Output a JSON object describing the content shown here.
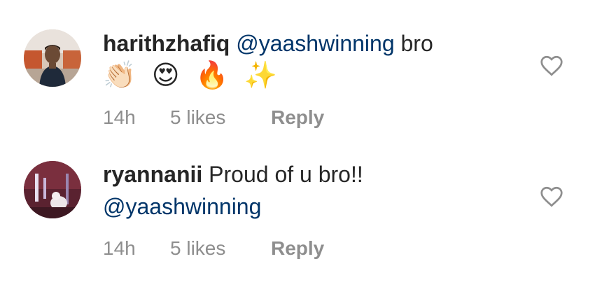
{
  "comments": [
    {
      "username": "harithzhafiq",
      "mention": "@yaashwinning",
      "text_after_mention": " bro",
      "emojis": "👏🏻 😍 🔥 ✨",
      "time": "14h",
      "likes": "5 likes",
      "reply": "Reply",
      "heart_icon": "heart-outline-icon"
    },
    {
      "username": "ryannanii",
      "text": " Proud of u bro!!",
      "mention": "@yaashwinning",
      "time": "14h",
      "likes": "5 likes",
      "reply": "Reply",
      "heart_icon": "heart-outline-icon"
    }
  ],
  "colors": {
    "text": "#262626",
    "mention": "#003569",
    "meta": "#8e8e8e"
  }
}
